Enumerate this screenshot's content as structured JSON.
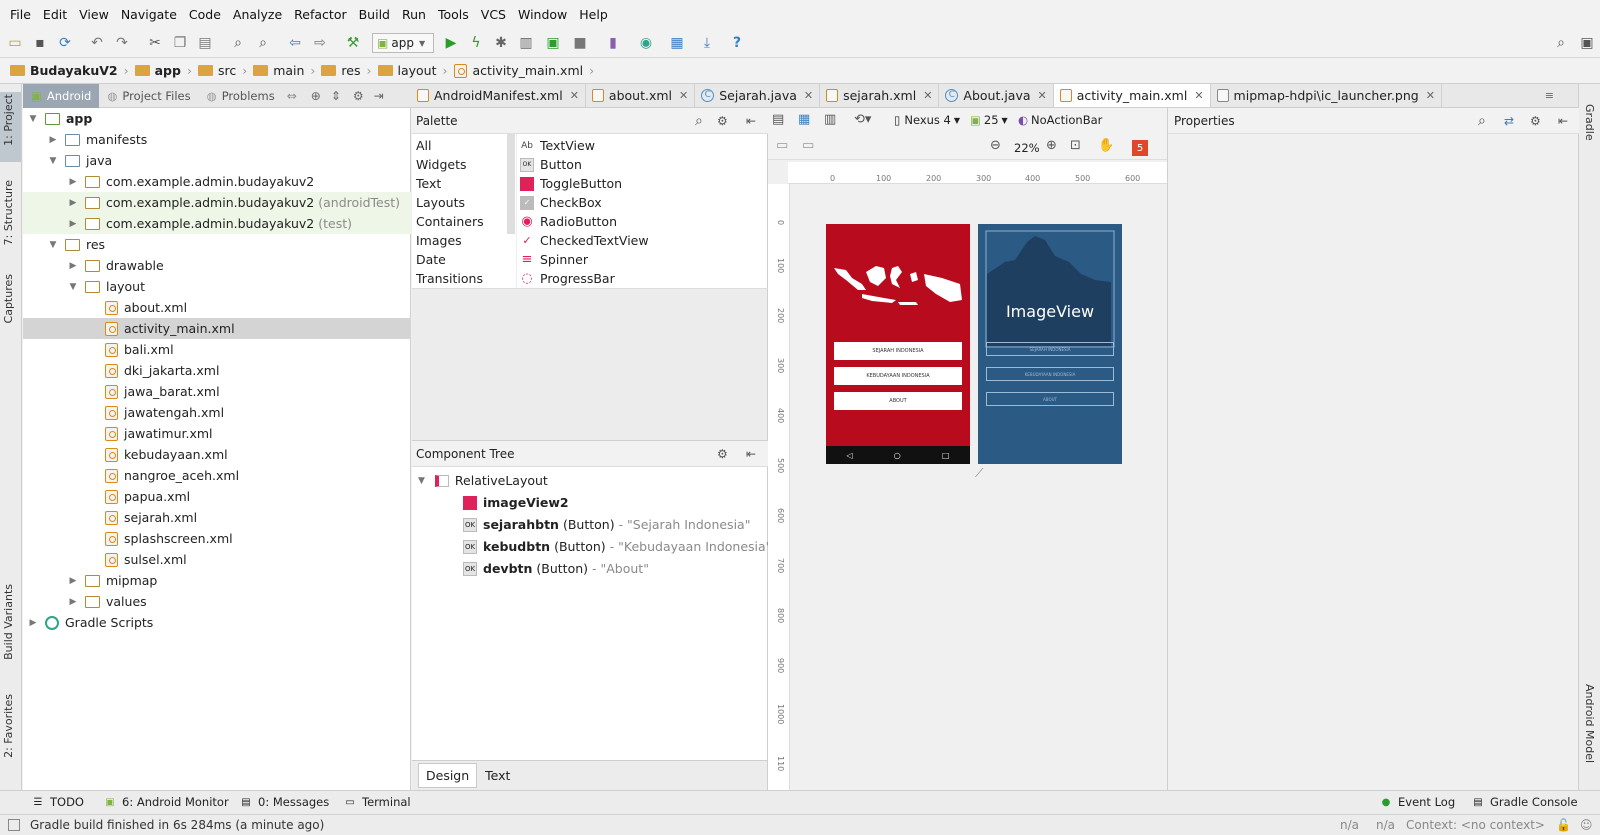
{
  "menu": [
    "File",
    "Edit",
    "View",
    "Navigate",
    "Code",
    "Analyze",
    "Refactor",
    "Build",
    "Run",
    "Tools",
    "VCS",
    "Window",
    "Help"
  ],
  "toolbar": {
    "run_config": "app"
  },
  "breadcrumb": [
    "BudayakuV2",
    "app",
    "src",
    "main",
    "res",
    "layout",
    "activity_main.xml"
  ],
  "left_strip": [
    "1: Project",
    "7: Structure",
    "Captures",
    "Build Variants",
    "2: Favorites"
  ],
  "right_strip": [
    "Gradle",
    "Android Model"
  ],
  "project_panel": {
    "tabs": [
      "Android",
      "Project Files",
      "Problems"
    ],
    "tree": [
      {
        "label": "app",
        "extra": ""
      },
      {
        "label": "manifests",
        "extra": ""
      },
      {
        "label": "java",
        "extra": ""
      },
      {
        "label": "com.example.admin.budayakuv2",
        "extra": ""
      },
      {
        "label": "com.example.admin.budayakuv2",
        "extra": "(androidTest)"
      },
      {
        "label": "com.example.admin.budayakuv2",
        "extra": "(test)"
      },
      {
        "label": "res",
        "extra": ""
      },
      {
        "label": "drawable",
        "extra": ""
      },
      {
        "label": "layout",
        "extra": ""
      },
      {
        "label": "about.xml",
        "extra": ""
      },
      {
        "label": "activity_main.xml",
        "extra": ""
      },
      {
        "label": "bali.xml",
        "extra": ""
      },
      {
        "label": "dki_jakarta.xml",
        "extra": ""
      },
      {
        "label": "jawa_barat.xml",
        "extra": ""
      },
      {
        "label": "jawatengah.xml",
        "extra": ""
      },
      {
        "label": "jawatimur.xml",
        "extra": ""
      },
      {
        "label": "kebudayaan.xml",
        "extra": ""
      },
      {
        "label": "nangroe_aceh.xml",
        "extra": ""
      },
      {
        "label": "papua.xml",
        "extra": ""
      },
      {
        "label": "sejarah.xml",
        "extra": ""
      },
      {
        "label": "splashscreen.xml",
        "extra": ""
      },
      {
        "label": "sulsel.xml",
        "extra": ""
      },
      {
        "label": "mipmap",
        "extra": ""
      },
      {
        "label": "values",
        "extra": ""
      },
      {
        "label": "Gradle Scripts",
        "extra": ""
      }
    ]
  },
  "editor_tabs": [
    "AndroidManifest.xml",
    "about.xml",
    "Sejarah.java",
    "sejarah.xml",
    "About.java",
    "activity_main.xml",
    "mipmap-hdpi\\ic_launcher.png"
  ],
  "palette": {
    "title": "Palette",
    "categories": [
      "All",
      "Widgets",
      "Text",
      "Layouts",
      "Containers",
      "Images",
      "Date",
      "Transitions"
    ],
    "items": [
      "TextView",
      "Button",
      "ToggleButton",
      "CheckBox",
      "RadioButton",
      "CheckedTextView",
      "Spinner",
      "ProgressBar"
    ]
  },
  "component_tree": {
    "title": "Component Tree",
    "root": "RelativeLayout",
    "children": [
      {
        "id": "imageView2",
        "type": "",
        "text": ""
      },
      {
        "id": "sejarahbtn",
        "type": "(Button)",
        "text": "- \"Sejarah Indonesia\""
      },
      {
        "id": "kebudbtn",
        "type": "(Button)",
        "text": "- \"Kebudayaan Indonesia\""
      },
      {
        "id": "devbtn",
        "type": "(Button)",
        "text": "- \"About\""
      }
    ]
  },
  "design_toolbar": {
    "device": "Nexus 4",
    "api": "25",
    "theme": "NoActionBar",
    "zoom": "22%",
    "warnings": "5"
  },
  "rulers": {
    "top": [
      "0",
      "100",
      "200",
      "300",
      "400",
      "500",
      "600"
    ],
    "left": [
      "0",
      "100",
      "200",
      "300",
      "400",
      "500",
      "600",
      "700",
      "800",
      "900",
      "1000",
      "110"
    ]
  },
  "preview": {
    "buttons": [
      "SEJARAH INDONESIA",
      "KEBUDAYAAN INDONESIA",
      "ABOUT"
    ],
    "blueprint_label": "ImageView",
    "blueprint_buttons": [
      "SEJARAH INDONESIA",
      "KEBUDAYAAN INDONESIA",
      "ABOUT"
    ]
  },
  "design_tabs": [
    "Design",
    "Text"
  ],
  "properties": {
    "title": "Properties"
  },
  "tool_windows_left": [
    "TODO",
    "6: Android Monitor",
    "0: Messages",
    "Terminal"
  ],
  "tool_windows_right": [
    "Event Log",
    "Gradle Console"
  ],
  "status": {
    "message": "Gradle build finished in 6s 284ms (a minute ago)",
    "na1": "n/a",
    "na2": "n/a",
    "context": "Context: <no context>"
  },
  "colors": {
    "accent_red": "#b80b1e",
    "blueprint": "#2b5a85",
    "selection": "#d4d4d4"
  }
}
